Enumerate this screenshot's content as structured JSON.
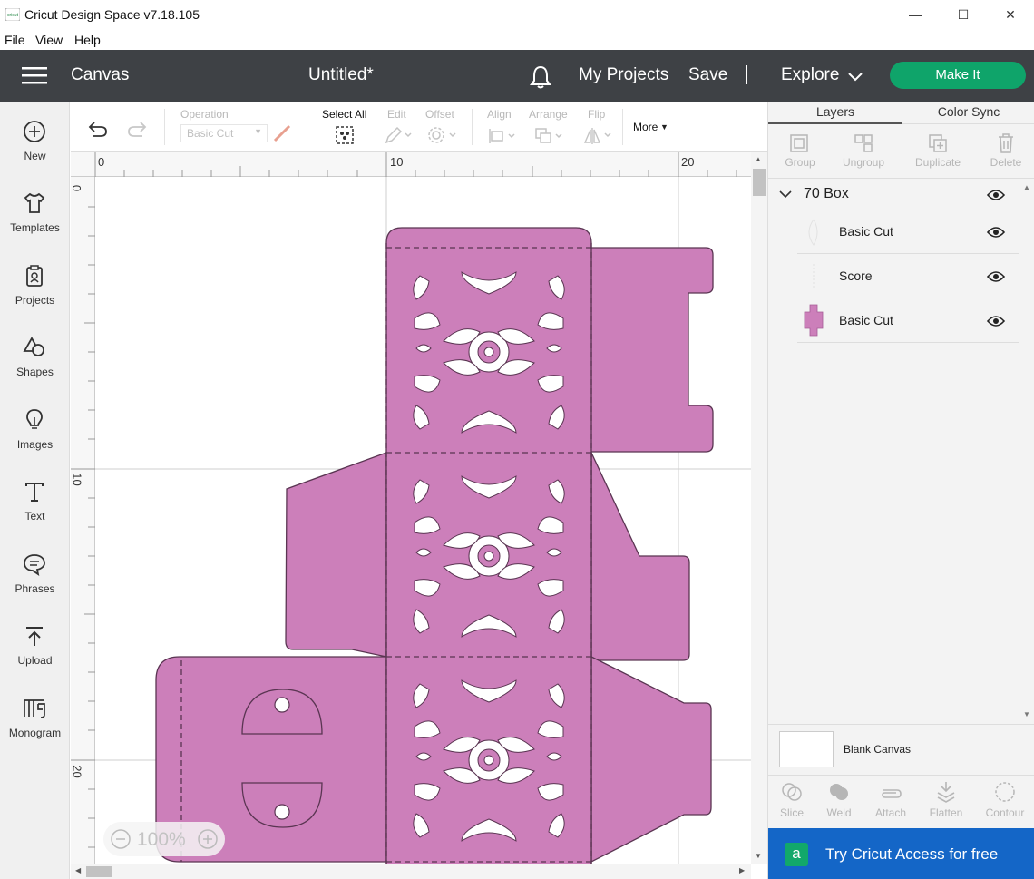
{
  "window": {
    "title": "Cricut Design Space  v7.18.105",
    "logo_text": "cricut",
    "controls": [
      "—",
      "☐",
      "✕"
    ]
  },
  "menu": [
    "File",
    "View",
    "Help"
  ],
  "header": {
    "section": "Canvas",
    "document": "Untitled*",
    "my_projects": "My Projects",
    "save": "Save",
    "explore": "Explore",
    "make_it": "Make It",
    "make_it_color": "#0fa46a",
    "bar_color": "#3e4145"
  },
  "sidebar": [
    {
      "label": "New",
      "icon": "plus-circle-icon"
    },
    {
      "label": "Templates",
      "icon": "shirt-icon"
    },
    {
      "label": "Projects",
      "icon": "clipboard-icon"
    },
    {
      "label": "Shapes",
      "icon": "shapes-icon"
    },
    {
      "label": "Images",
      "icon": "bulb-icon"
    },
    {
      "label": "Text",
      "icon": "text-icon"
    },
    {
      "label": "Phrases",
      "icon": "speech-bubble-icon"
    },
    {
      "label": "Upload",
      "icon": "upload-icon"
    },
    {
      "label": "Monogram",
      "icon": "monogram-icon"
    }
  ],
  "toolbar": {
    "operation_label": "Operation",
    "operation_value": "Basic Cut",
    "select_all": "Select All",
    "edit": "Edit",
    "offset": "Offset",
    "align": "Align",
    "arrange": "Arrange",
    "flip": "Flip",
    "more": "More"
  },
  "rulers": {
    "top": [
      "0",
      "10",
      "20"
    ],
    "left": [
      "0",
      "10",
      "20"
    ]
  },
  "zoom": {
    "value": "100%"
  },
  "design": {
    "fill_color": "#cc7fba",
    "stroke_color": "#5a3552"
  },
  "right_panel": {
    "tabs": [
      "Layers",
      "Color Sync"
    ],
    "actions": [
      "Group",
      "Ungroup",
      "Duplicate",
      "Delete"
    ],
    "group_name": "70 Box",
    "layers": [
      {
        "label": "Basic Cut"
      },
      {
        "label": "Score"
      },
      {
        "label": "Basic Cut"
      }
    ],
    "blank_canvas": "Blank Canvas",
    "bottom_actions": [
      "Slice",
      "Weld",
      "Attach",
      "Flatten",
      "Contour"
    ],
    "promo": "Try Cricut Access for free",
    "promo_badge": "a",
    "promo_color": "#1466c7"
  }
}
